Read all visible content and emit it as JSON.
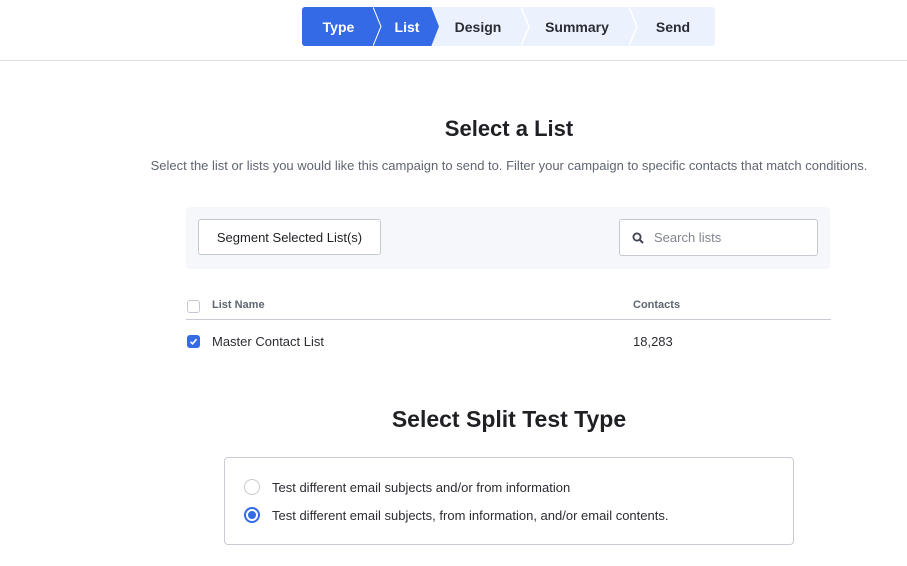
{
  "stepper": {
    "steps": [
      {
        "label": "Type",
        "state": "completed"
      },
      {
        "label": "List",
        "state": "active"
      },
      {
        "label": "Design",
        "state": "upcoming"
      },
      {
        "label": "Summary",
        "state": "upcoming"
      },
      {
        "label": "Send",
        "state": "upcoming"
      }
    ]
  },
  "list_section": {
    "title": "Select a List",
    "subtitle": "Select the list or lists you would like this campaign to send to. Filter your campaign to specific contacts that match conditions.",
    "segment_button": "Segment Selected List(s)",
    "search": {
      "placeholder": "Search lists",
      "value": ""
    },
    "table": {
      "columns": [
        "List Name",
        "Contacts"
      ],
      "select_all_checked": false,
      "rows": [
        {
          "checked": true,
          "name": "Master Contact List",
          "contacts": "18,283"
        }
      ]
    }
  },
  "split_section": {
    "title": "Select Split Test Type",
    "options": [
      {
        "label": "Test different email subjects and/or from information",
        "selected": false
      },
      {
        "label": "Test different email subjects, from information, and/or email contents.",
        "selected": true
      }
    ]
  },
  "colors": {
    "accent": "#356ae6",
    "stepper_bg": "#ebf2fd",
    "toolbar_bg": "#f5f7fb"
  }
}
